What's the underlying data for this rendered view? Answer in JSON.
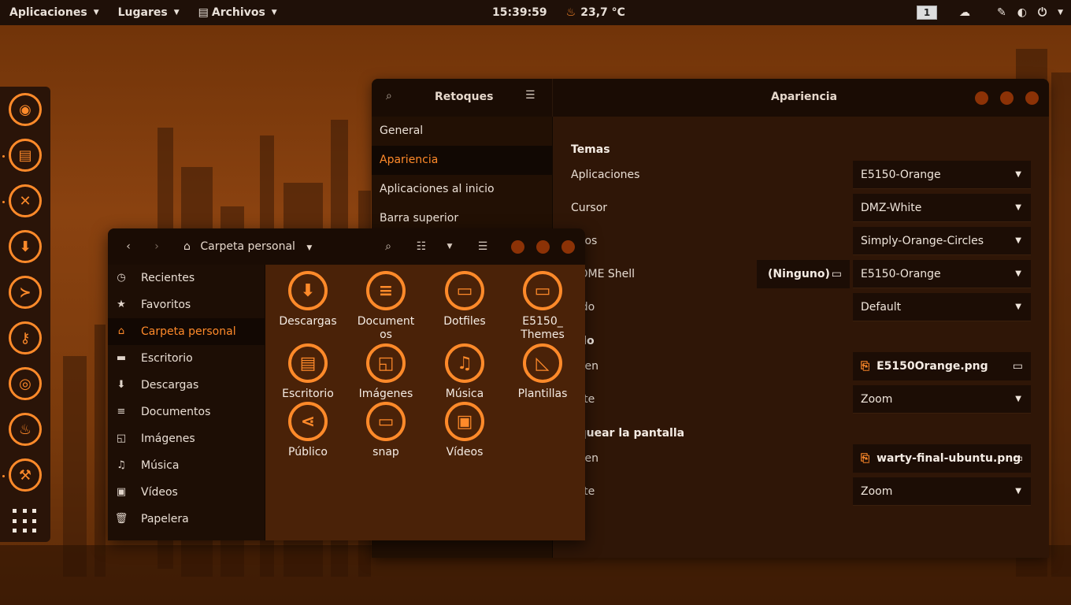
{
  "topbar": {
    "menus": [
      "Aplicaciones",
      "Lugares",
      "Archivos"
    ],
    "clock": "15:39:59",
    "temperature": "23,7 °C",
    "workspace": "1"
  },
  "dock": {
    "items": [
      "firefox-icon",
      "files-icon",
      "tweaks-icon",
      "software-icon",
      "terminal-icon",
      "passwords-icon",
      "image-viewer-icon",
      "genie-icon",
      "tools-icon"
    ],
    "show_apps": "apps-grid-icon"
  },
  "tweaks": {
    "sidebar_title": "Retoques",
    "title": "Apariencia",
    "sidebar": [
      "General",
      "Apariencia",
      "Aplicaciones al inicio",
      "Barra superior"
    ],
    "sections": {
      "temas": "Temas",
      "fondo": "ndo",
      "bloquear": "oquear la pantalla"
    },
    "labels": {
      "aplicaciones": "Aplicaciones",
      "cursor": "Cursor",
      "iconos": "onos",
      "shell": "NOME Shell",
      "sonido": "nido",
      "fondo_imagen": "agen",
      "fondo_ajuste": "uste",
      "lock_imagen": "agen",
      "lock_ajuste": "uste"
    },
    "values": {
      "aplicaciones": "E5150-Orange",
      "cursor": "DMZ-White",
      "iconos": "Simply-Orange-Circles",
      "shell_none": "(Ninguno)",
      "shell": "E5150-Orange",
      "sonido": "Default",
      "fondo_imagen": "E5150Orange.png",
      "fondo_ajuste": "Zoom",
      "lock_imagen": "warty-final-ubuntu.png",
      "lock_ajuste": "Zoom"
    }
  },
  "files": {
    "path": "Carpeta personal",
    "sidebar": [
      "Recientes",
      "Favoritos",
      "Carpeta personal",
      "Escritorio",
      "Descargas",
      "Documentos",
      "Imágenes",
      "Música",
      "Vídeos",
      "Papelera"
    ],
    "items": [
      "Descargas",
      "Documentos",
      "Dotfiles",
      "E5150_ Themes",
      "Escritorio",
      "Imágenes",
      "Música",
      "Plantillas",
      "Público",
      "snap",
      "Vídeos"
    ]
  },
  "colors": {
    "accent": "#ff8a2a",
    "topbar": "#1f1008",
    "window_bg": "#2f1607"
  }
}
